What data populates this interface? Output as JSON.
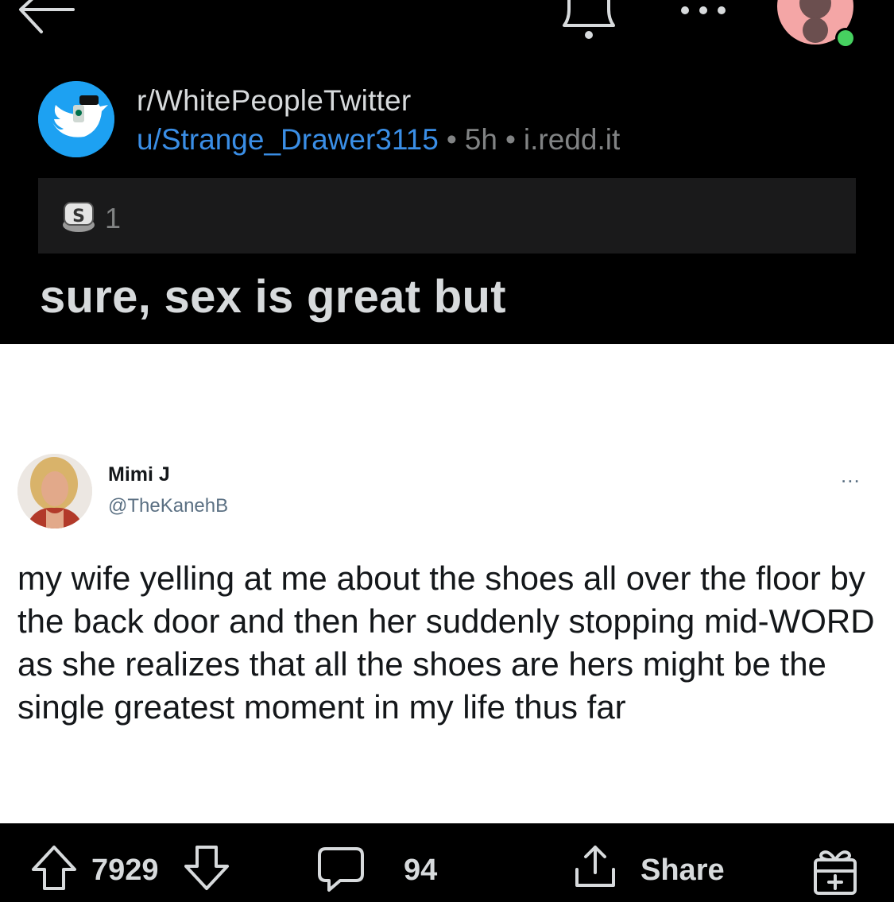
{
  "topbar": {
    "back_icon": "arrow-left-icon",
    "bell_icon": "bell-icon",
    "more_icon": "more-horizontal-icon",
    "avatar_icon": "user-avatar-icon",
    "online_color": "#46d160"
  },
  "post": {
    "subreddit": "r/WhitePeopleTwitter",
    "author": "u/Strange_Drawer3115",
    "sep1": "•",
    "age": "5h",
    "sep2": "•",
    "domain": "i.redd.it",
    "award_count": "1",
    "title": "sure, sex is great but"
  },
  "tweet": {
    "name": "Mimi J",
    "handle": "@TheKanehB",
    "more": "...",
    "text": "my wife yelling at me about the shoes all over the floor by the back door and then her suddenly stopping mid-WORD as she realizes that all the shoes are hers might be the single greatest moment in my life thus far"
  },
  "actions": {
    "vote_count": "7929",
    "comment_count": "94",
    "share_label": "Share"
  },
  "colors": {
    "background": "#000000",
    "username": "#3a8ee6",
    "text": "#d7dadc",
    "muted": "#818384",
    "award_bar": "#1a1a1b",
    "twitter_blue": "#1da1f2"
  }
}
